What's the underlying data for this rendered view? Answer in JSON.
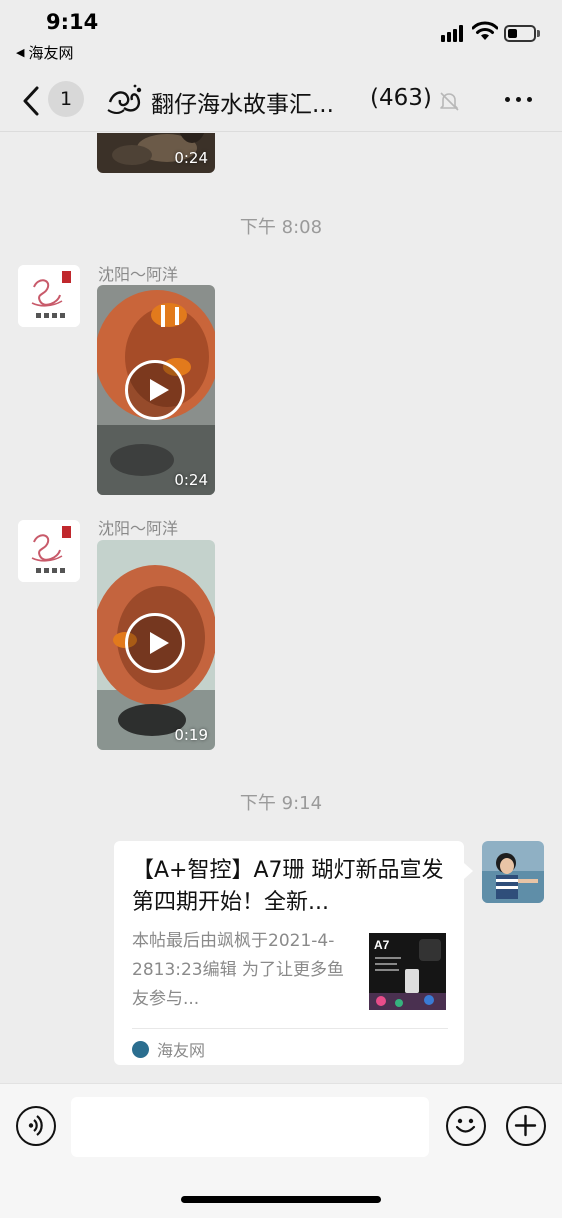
{
  "status_bar": {
    "time": "9:14",
    "back_app": "海友网"
  },
  "nav": {
    "unread_count": "1",
    "title": "翻仔海水故事汇...",
    "member_count": "(463)",
    "icons": [
      "back-chevron-icon",
      "group-logo-icon",
      "mute-bell-icon",
      "more-icon"
    ]
  },
  "messages": [
    {
      "type": "video",
      "duration": "0:24"
    },
    {
      "type": "timestamp",
      "text": "下午 8:08"
    },
    {
      "type": "video",
      "sender": "沈阳～阿洋",
      "duration": "0:24"
    },
    {
      "type": "video",
      "sender": "沈阳～阿洋",
      "duration": "0:19"
    },
    {
      "type": "timestamp",
      "text": "下午 9:14"
    },
    {
      "type": "link",
      "title": "【A+智控】A7珊 瑚灯新品宣发 第四期开始！全新...",
      "description": "本帖最后由飒枫于2021-4-2813:23编辑 为了让更多鱼友参与...",
      "source": "海友网",
      "thumb_label": "A7"
    }
  ],
  "input_bar": {
    "icons": [
      "voice-icon",
      "emoji-icon",
      "plus-icon"
    ]
  },
  "colors": {
    "background": "#ededed",
    "bubble": "#ffffff",
    "timestamp": "#9a9a9a"
  }
}
